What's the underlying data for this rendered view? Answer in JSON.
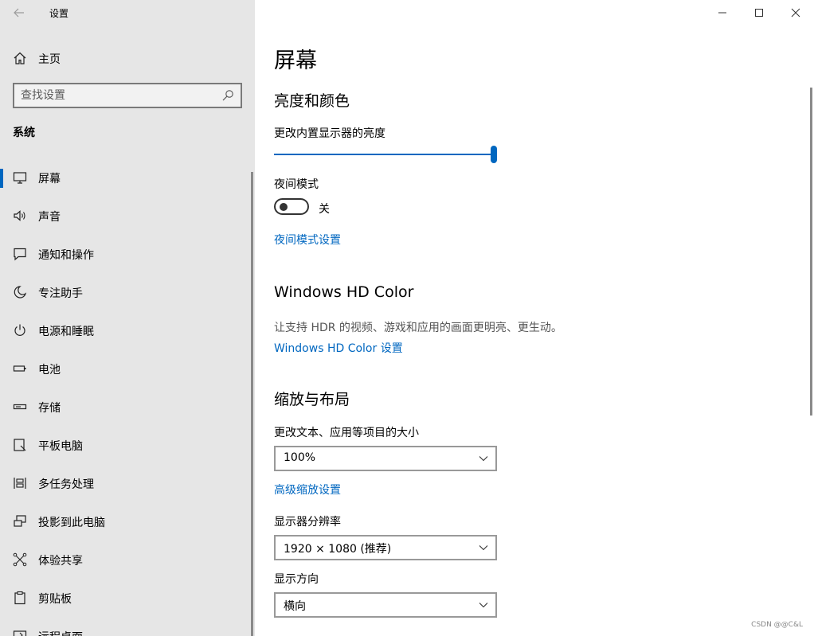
{
  "app": {
    "title": "设置"
  },
  "sidebar": {
    "home_label": "主页",
    "search_placeholder": "查找设置",
    "section": "系统",
    "items": [
      {
        "label": "屏幕",
        "icon": "monitor-icon",
        "selected": true
      },
      {
        "label": "声音",
        "icon": "speaker-icon"
      },
      {
        "label": "通知和操作",
        "icon": "notification-icon"
      },
      {
        "label": "专注助手",
        "icon": "moon-icon"
      },
      {
        "label": "电源和睡眠",
        "icon": "power-icon"
      },
      {
        "label": "电池",
        "icon": "battery-icon"
      },
      {
        "label": "存储",
        "icon": "storage-icon"
      },
      {
        "label": "平板电脑",
        "icon": "tablet-icon"
      },
      {
        "label": "多任务处理",
        "icon": "multitask-icon"
      },
      {
        "label": "投影到此电脑",
        "icon": "project-icon"
      },
      {
        "label": "体验共享",
        "icon": "share-icon"
      },
      {
        "label": "剪贴板",
        "icon": "clipboard-icon"
      },
      {
        "label": "远程桌面",
        "icon": "remote-desktop-icon"
      }
    ]
  },
  "main": {
    "page_title": "屏幕",
    "brightness": {
      "heading": "亮度和颜色",
      "label": "更改内置显示器的亮度",
      "value_percent": 100
    },
    "night_light": {
      "label": "夜间模式",
      "state": "关",
      "on": false,
      "settings_link": "夜间模式设置"
    },
    "hd_color": {
      "heading": "Windows HD Color",
      "description": "让支持 HDR 的视频、游戏和应用的画面更明亮、更生动。",
      "link": "Windows HD Color 设置"
    },
    "scale": {
      "heading": "缩放与布局",
      "label": "更改文本、应用等项目的大小",
      "value": "100%",
      "advanced_link": "高级缩放设置"
    },
    "resolution": {
      "label": "显示器分辨率",
      "value": "1920 × 1080 (推荐)"
    },
    "orientation": {
      "label": "显示方向",
      "value": "横向"
    }
  },
  "watermark": "CSDN @@C&L",
  "colors": {
    "accent": "#0067c0",
    "sidebar_bg": "#e6e6e6"
  }
}
